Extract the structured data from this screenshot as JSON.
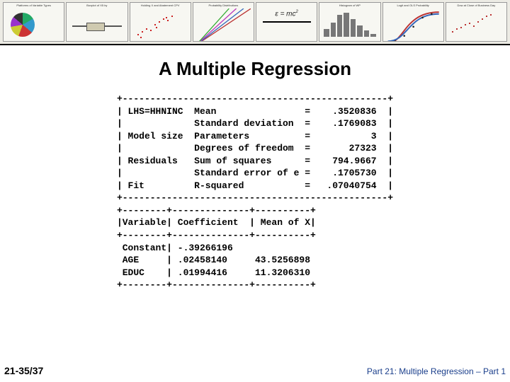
{
  "thumbs": [
    {
      "label": "Platforms of Variable Types"
    },
    {
      "label": "Boxplot of X5 by"
    },
    {
      "label": "Holding X and Abatement CPV"
    },
    {
      "label": "Probability Distributions"
    },
    {
      "label": ""
    },
    {
      "label": "Histogram of WP"
    },
    {
      "label": "Logit and OLS Probability"
    },
    {
      "label": "Dow at Close of Business Day"
    }
  ],
  "title": "A Multiple Regression",
  "stats_block": {
    "rule_long": "+------------------------------------------------+",
    "rows": [
      {
        "section": "LHS=HHNINC",
        "label": "Mean",
        "value": ".3520836"
      },
      {
        "section": "",
        "label": "Standard deviation",
        "value": ".1769083"
      },
      {
        "section": "Model size",
        "label": "Parameters",
        "value": "3"
      },
      {
        "section": "",
        "label": "Degrees of freedom",
        "value": "27323"
      },
      {
        "section": "Residuals",
        "label": "Sum of squares",
        "value": "794.9667"
      },
      {
        "section": "",
        "label": "Standard error of e",
        "value": ".1705730"
      },
      {
        "section": "Fit",
        "label": "R-squared",
        "value": ".07040754"
      }
    ]
  },
  "coef_block": {
    "rule": "+--------+--------------+----------+",
    "header": "|Variable| Coefficient  | Mean of X|",
    "rows": [
      {
        "var": "Constant",
        "coef": "-.39266196",
        "meanx": ""
      },
      {
        "var": "AGE",
        "coef": ".02458140",
        "meanx": "43.5256898"
      },
      {
        "var": "EDUC",
        "coef": ".01994416",
        "meanx": "11.3206310"
      }
    ]
  },
  "footer": {
    "left": "21-35/37",
    "right": "Part 21: Multiple Regression – Part 1"
  }
}
